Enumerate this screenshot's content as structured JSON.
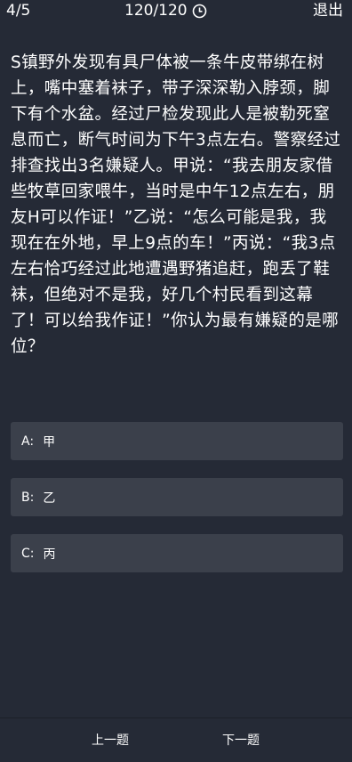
{
  "header": {
    "progress": "4/5",
    "timer": "120/120",
    "timer_icon": "clock-icon",
    "exit_label": "退出"
  },
  "question": {
    "text": "S镇野外发现有具尸体被一条牛皮带绑在树上，嘴中塞着袜子，带子深深勒入脖颈，脚下有个水盆。经过尸检发现此人是被勒死窒息而亡，断气时间为下午3点左右。警察经过排查找出3名嫌疑人。甲说：“我去朋友家借些牧草回家喂牛，当时是中午12点左右，朋友H可以作证！”乙说：“怎么可能是我，我现在在外地，早上9点的车！”丙说：“我3点左右恰巧经过此地遭遇野猪追赶，跑丢了鞋袜，但绝对不是我，好几个村民看到这幕了！可以给我作证！”你认为最有嫌疑的是哪位？"
  },
  "options": [
    {
      "key": "A:",
      "text": "甲"
    },
    {
      "key": "B:",
      "text": "乙"
    },
    {
      "key": "C:",
      "text": "丙"
    }
  ],
  "footer": {
    "prev_label": "上一题",
    "next_label": "下一题"
  }
}
